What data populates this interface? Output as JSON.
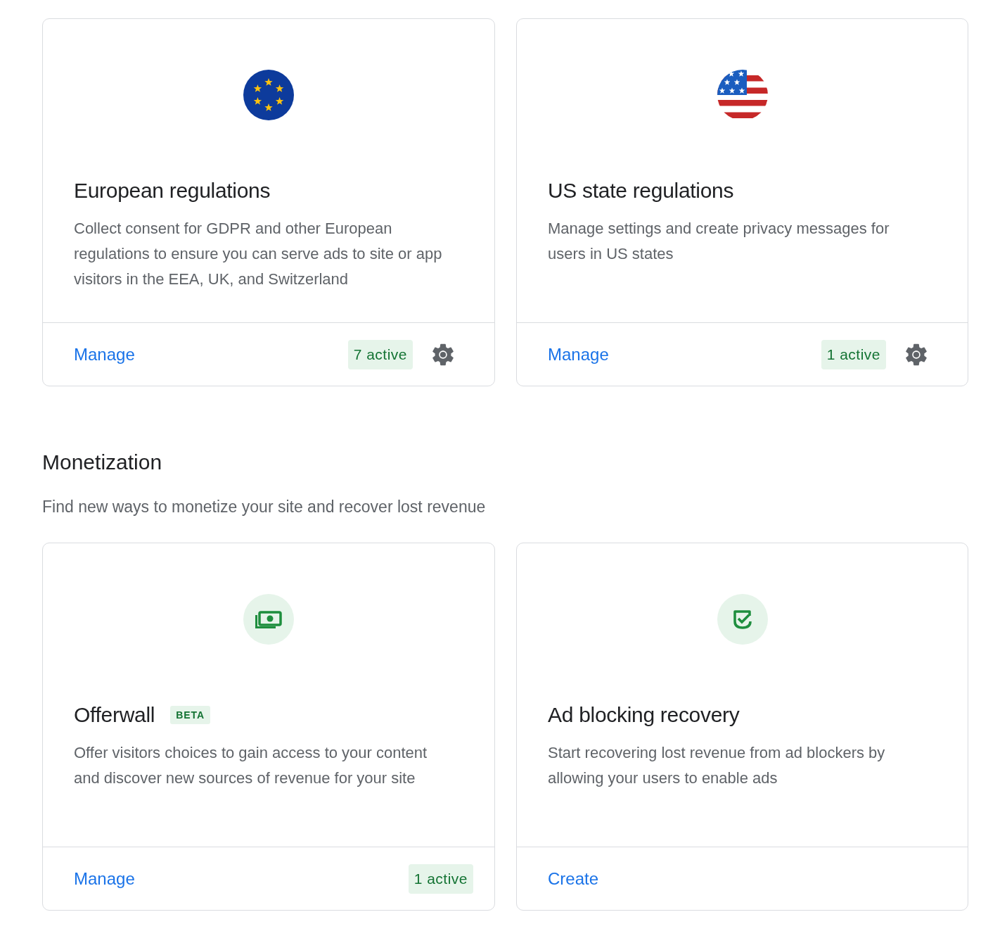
{
  "sections": [
    {
      "cards": [
        {
          "kind": "eu-flag",
          "title": "European regulations",
          "description": "Collect consent for GDPR and other European regulations to ensure you can serve ads to site or app visitors in the EEA, UK, and Switzerland",
          "action": "Manage",
          "badge": "7 active",
          "settings": true
        },
        {
          "kind": "us-flag",
          "title": "US state regulations",
          "description": "Manage settings and create privacy messages for users in US states",
          "action": "Manage",
          "badge": "1 active",
          "settings": true
        }
      ]
    },
    {
      "heading": "Monetization",
      "description": "Find new ways to monetize your site and recover lost revenue",
      "cards": [
        {
          "kind": "cash",
          "title": "Offerwall",
          "tag": "BETA",
          "description": "Offer visitors choices to gain access to your content and discover new sources of revenue for your site",
          "action": "Manage",
          "badge": "1 active",
          "settings": false
        },
        {
          "kind": "shield-check",
          "title": "Ad blocking recovery",
          "description": "Start recovering lost revenue from ad blockers by allowing your users to enable ads",
          "action": "Create",
          "settings": false
        }
      ]
    }
  ]
}
